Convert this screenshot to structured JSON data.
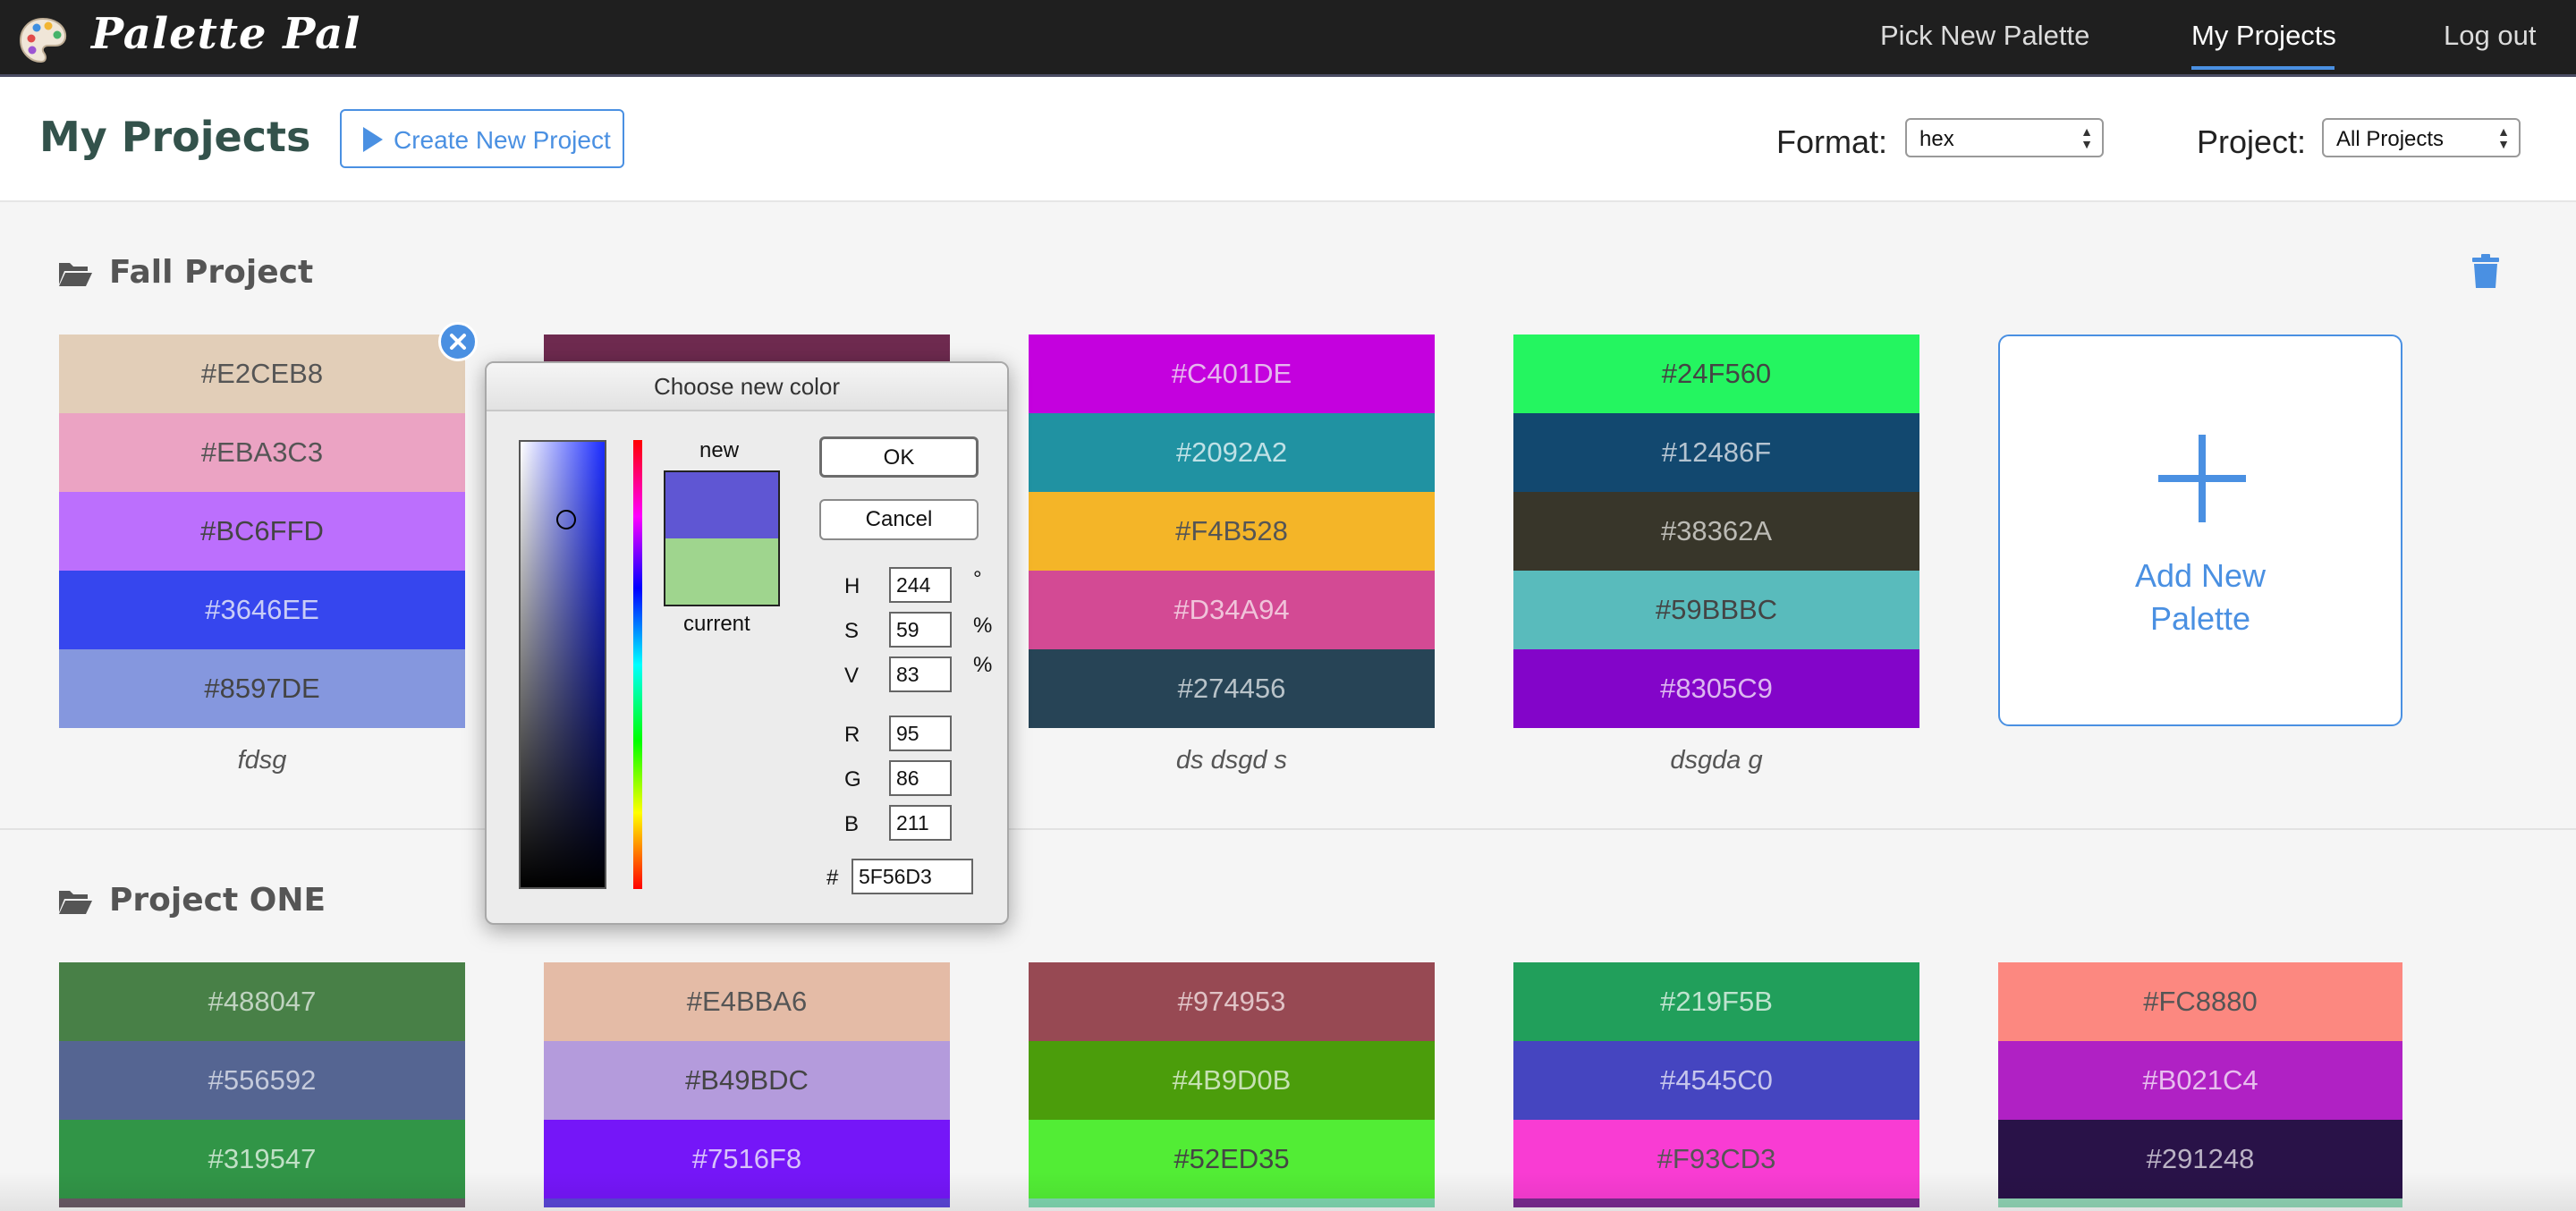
{
  "app": {
    "name": "Palette Pal",
    "nav": [
      "Pick New Palette",
      "My Projects",
      "Log out"
    ]
  },
  "header": {
    "title": "My Projects",
    "create_label": "Create New Project",
    "format_label": "Format:",
    "format_value": "hex",
    "project_label": "Project:",
    "project_value": "All Projects"
  },
  "sections": [
    {
      "title": "Fall Project",
      "palettes": [
        {
          "name": "fdsg",
          "colors": [
            "#E2CEB8",
            "#EBA3C3",
            "#BC6FFD",
            "#3646EE",
            "#8597DE"
          ]
        },
        {
          "name": "",
          "colors": [
            "",
            "",
            "",
            "",
            ""
          ]
        },
        {
          "name": "ds dsgd s",
          "colors": [
            "#C401DE",
            "#2092A2",
            "#F4B528",
            "#D34A94",
            "#274456"
          ]
        },
        {
          "name": "dsgda g",
          "colors": [
            "#24F560",
            "#12486F",
            "#38362A",
            "#59BBBC",
            "#8305C9"
          ]
        }
      ],
      "add_label": "Add New Palette"
    },
    {
      "title": "Project ONE",
      "palettes": [
        {
          "colors": [
            "#488047",
            "#556592",
            "#319547"
          ]
        },
        {
          "colors": [
            "#E4BBA6",
            "#B49BDC",
            "#7516F8"
          ]
        },
        {
          "colors": [
            "#974953",
            "#4B9D0B",
            "#52ED35"
          ]
        },
        {
          "colors": [
            "#219F5B",
            "#4545C0",
            "#F93CD3"
          ]
        },
        {
          "colors": [
            "#FC8880",
            "#B021C4",
            "#291248"
          ]
        }
      ]
    }
  ],
  "color_picker": {
    "title": "Choose new color",
    "new_label": "new",
    "current_label": "current",
    "new_color": "#5F56D3",
    "current_color": "#9FD58E",
    "ok_label": "OK",
    "cancel_label": "Cancel",
    "h_label": "H",
    "h_value": "244",
    "h_unit": "°",
    "s_label": "S",
    "s_value": "59",
    "s_unit": "%",
    "v_label": "V",
    "v_value": "83",
    "v_unit": "%",
    "r_label": "R",
    "r_value": "95",
    "g_label": "G",
    "g_value": "86",
    "b_label": "B",
    "b_value": "211",
    "hash_label": "#",
    "hex_value": "5F56D3"
  },
  "colors": {
    "accent": "#4a90e2",
    "navbar": "#1f1f1f",
    "title": "#33524b",
    "palette2_top": "#6E2A4F"
  }
}
